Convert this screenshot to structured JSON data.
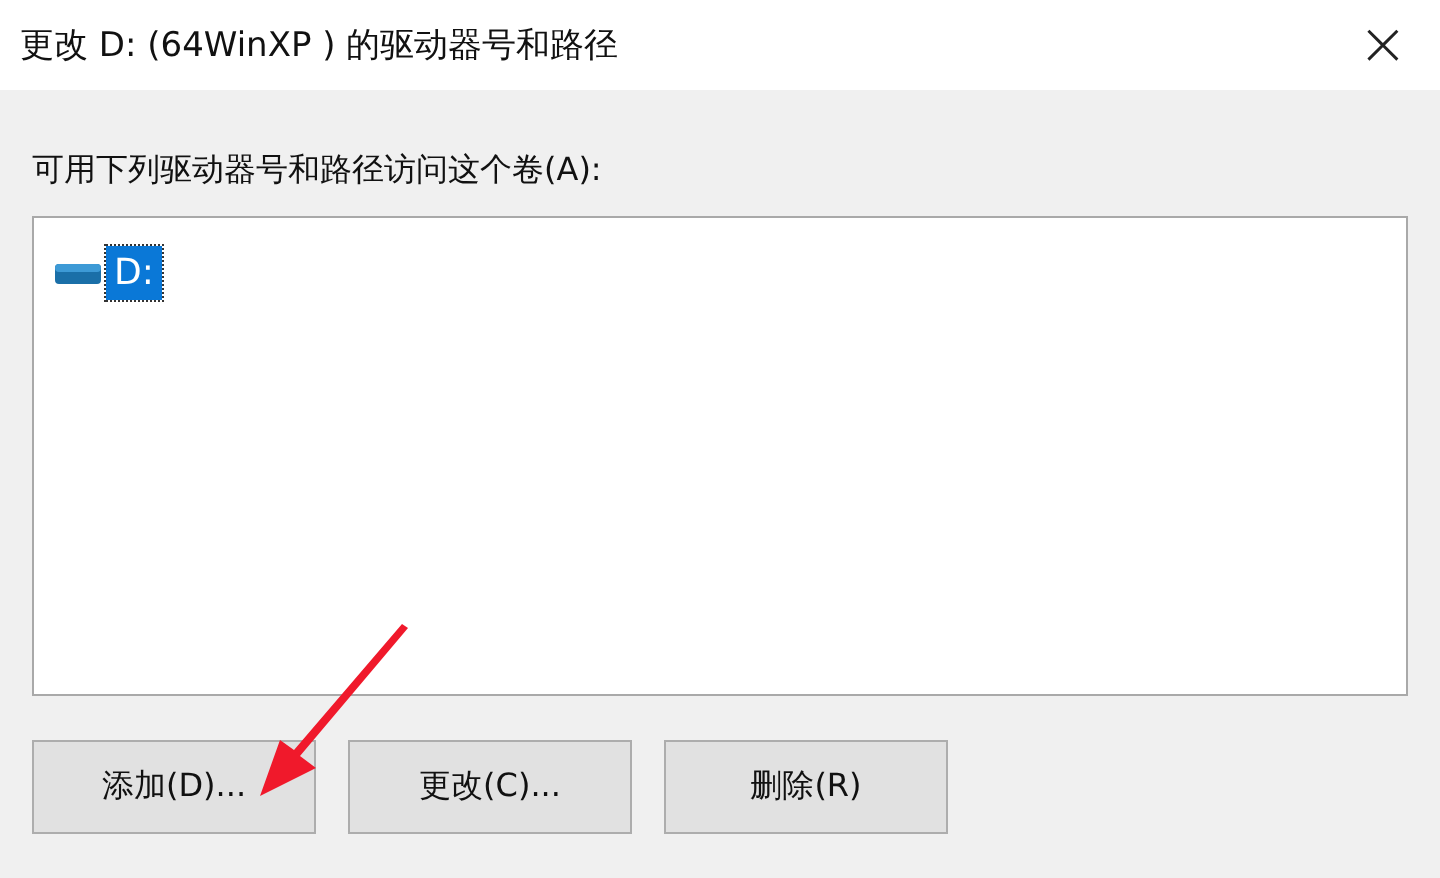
{
  "window": {
    "title": "更改 D: (64WinXP ) 的驱动器号和路径",
    "close": "×"
  },
  "prompt": "可用下列驱动器号和路径访问这个卷(A):",
  "paths": [
    {
      "label": "D:",
      "selected": true
    }
  ],
  "buttons": [
    {
      "label": "添加(D)..."
    },
    {
      "label": "更改(C)..."
    },
    {
      "label": "删除(R)"
    }
  ]
}
